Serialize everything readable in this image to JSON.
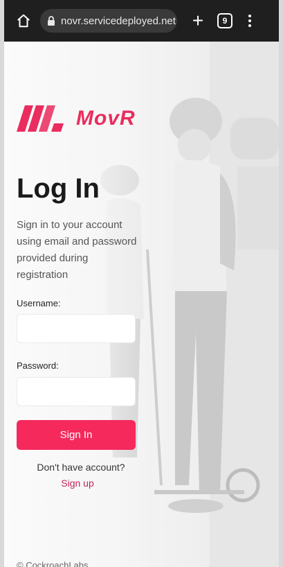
{
  "browser": {
    "url": "novr.servicedeployed.net",
    "tab_count": "9",
    "icons": {
      "home": "home-icon",
      "lock": "lock-icon",
      "new_tab": "plus-icon",
      "tabs": "tab-switcher-icon",
      "menu": "overflow-menu-icon"
    }
  },
  "brand": {
    "name": "MovR",
    "color": "#ea2c5e"
  },
  "login": {
    "title": "Log In",
    "subtitle": "Sign in to your account using email and password provided during registration",
    "username_label": "Username:",
    "username_value": "",
    "password_label": "Password:",
    "password_value": "",
    "submit_label": "Sign In",
    "submit_color": "#f5295c",
    "no_account_text": "Don't have account?",
    "signup_label": "Sign up"
  },
  "footer": {
    "text": "© CockroachLabs"
  }
}
